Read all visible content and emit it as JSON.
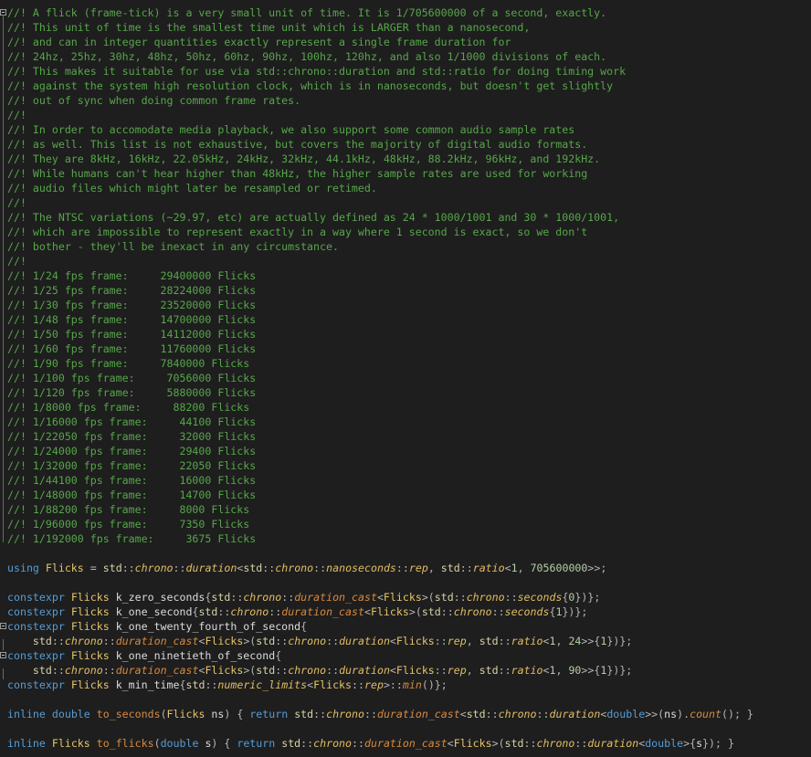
{
  "comments": [
    "//! A flick (frame-tick) is a very small unit of time. It is 1/705600000 of a second, exactly.",
    "//! This unit of time is the smallest time unit which is LARGER than a nanosecond,",
    "//! and can in integer quantities exactly represent a single frame duration for",
    "//! 24hz, 25hz, 30hz, 48hz, 50hz, 60hz, 90hz, 100hz, 120hz, and also 1/1000 divisions of each.",
    "//! This makes it suitable for use via std::chrono::duration and std::ratio for doing timing work",
    "//! against the system high resolution clock, which is in nanoseconds, but doesn't get slightly",
    "//! out of sync when doing common frame rates.",
    "//!",
    "//! In order to accomodate media playback, we also support some common audio sample rates",
    "//! as well. This list is not exhaustive, but covers the majority of digital audio formats.",
    "//! They are 8kHz, 16kHz, 22.05kHz, 24kHz, 32kHz, 44.1kHz, 48kHz, 88.2kHz, 96kHz, and 192kHz.",
    "//! While humans can't hear higher than 48kHz, the higher sample rates are used for working",
    "//! audio files which might later be resampled or retimed.",
    "//!",
    "//! The NTSC variations (~29.97, etc) are actually defined as 24 * 1000/1001 and 30 * 1000/1001,",
    "//! which are impossible to represent exactly in a way where 1 second is exact, so we don't",
    "//! bother - they'll be inexact in any circumstance.",
    "//!",
    "//! 1/24 fps frame:     29400000 Flicks",
    "//! 1/25 fps frame:     28224000 Flicks",
    "//! 1/30 fps frame:     23520000 Flicks",
    "//! 1/48 fps frame:     14700000 Flicks",
    "//! 1/50 fps frame:     14112000 Flicks",
    "//! 1/60 fps frame:     11760000 Flicks",
    "//! 1/90 fps frame:     7840000 Flicks",
    "//! 1/100 fps frame:     7056000 Flicks",
    "//! 1/120 fps frame:     5880000 Flicks",
    "//! 1/8000 fps frame:     88200 Flicks",
    "//! 1/16000 fps frame:     44100 Flicks",
    "//! 1/22050 fps frame:     32000 Flicks",
    "//! 1/24000 fps frame:     29400 Flicks",
    "//! 1/32000 fps frame:     22050 Flicks",
    "//! 1/44100 fps frame:     16000 Flicks",
    "//! 1/48000 fps frame:     14700 Flicks",
    "//! 1/88200 fps frame:     8000 Flicks",
    "//! 1/96000 fps frame:     7350 Flicks",
    "//! 1/192000 fps frame:     3675 Flicks"
  ],
  "code": [
    [],
    [
      [
        "kw",
        "using"
      ],
      [
        "p",
        " "
      ],
      [
        "ty",
        "Flicks"
      ],
      [
        "p",
        " = "
      ],
      [
        "ns",
        "std"
      ],
      [
        "p",
        "::"
      ],
      [
        "it",
        "chrono"
      ],
      [
        "p",
        "::"
      ],
      [
        "it",
        "duration"
      ],
      [
        "p",
        "<"
      ],
      [
        "ns",
        "std"
      ],
      [
        "p",
        "::"
      ],
      [
        "it",
        "chrono"
      ],
      [
        "p",
        "::"
      ],
      [
        "it",
        "nanoseconds"
      ],
      [
        "p",
        "::"
      ],
      [
        "it",
        "rep"
      ],
      [
        "p",
        ", "
      ],
      [
        "ns",
        "std"
      ],
      [
        "p",
        "::"
      ],
      [
        "it",
        "ratio"
      ],
      [
        "p",
        "<"
      ],
      [
        "num",
        "1"
      ],
      [
        "p",
        ", "
      ],
      [
        "num",
        "705600000"
      ],
      [
        "p",
        ">>;"
      ]
    ],
    [],
    [
      [
        "kw",
        "constexpr"
      ],
      [
        "p",
        " "
      ],
      [
        "ty",
        "Flicks"
      ],
      [
        "p",
        " "
      ],
      [
        "id",
        "k_zero_seconds"
      ],
      [
        "p",
        "{"
      ],
      [
        "ns",
        "std"
      ],
      [
        "p",
        "::"
      ],
      [
        "it",
        "chrono"
      ],
      [
        "p",
        "::"
      ],
      [
        "fn",
        "duration_cast"
      ],
      [
        "p",
        "<"
      ],
      [
        "ty",
        "Flicks"
      ],
      [
        "p",
        ">("
      ],
      [
        "ns",
        "std"
      ],
      [
        "p",
        "::"
      ],
      [
        "it",
        "chrono"
      ],
      [
        "p",
        "::"
      ],
      [
        "it",
        "seconds"
      ],
      [
        "p",
        "{"
      ],
      [
        "num",
        "0"
      ],
      [
        "p",
        "})};"
      ]
    ],
    [
      [
        "kw",
        "constexpr"
      ],
      [
        "p",
        " "
      ],
      [
        "ty",
        "Flicks"
      ],
      [
        "p",
        " "
      ],
      [
        "id",
        "k_one_second"
      ],
      [
        "p",
        "{"
      ],
      [
        "ns",
        "std"
      ],
      [
        "p",
        "::"
      ],
      [
        "it",
        "chrono"
      ],
      [
        "p",
        "::"
      ],
      [
        "fn",
        "duration_cast"
      ],
      [
        "p",
        "<"
      ],
      [
        "ty",
        "Flicks"
      ],
      [
        "p",
        ">("
      ],
      [
        "ns",
        "std"
      ],
      [
        "p",
        "::"
      ],
      [
        "it",
        "chrono"
      ],
      [
        "p",
        "::"
      ],
      [
        "it",
        "seconds"
      ],
      [
        "p",
        "{"
      ],
      [
        "num",
        "1"
      ],
      [
        "p",
        "})};"
      ]
    ],
    [
      [
        "kw",
        "constexpr"
      ],
      [
        "p",
        " "
      ],
      [
        "ty",
        "Flicks"
      ],
      [
        "p",
        " "
      ],
      [
        "id",
        "k_one_twenty_fourth_of_second"
      ],
      [
        "p",
        "{"
      ]
    ],
    [
      [
        "p",
        "    "
      ],
      [
        "ns",
        "std"
      ],
      [
        "p",
        "::"
      ],
      [
        "it",
        "chrono"
      ],
      [
        "p",
        "::"
      ],
      [
        "fn",
        "duration_cast"
      ],
      [
        "p",
        "<"
      ],
      [
        "ty",
        "Flicks"
      ],
      [
        "p",
        ">("
      ],
      [
        "ns",
        "std"
      ],
      [
        "p",
        "::"
      ],
      [
        "it",
        "chrono"
      ],
      [
        "p",
        "::"
      ],
      [
        "it",
        "duration"
      ],
      [
        "p",
        "<"
      ],
      [
        "ty",
        "Flicks"
      ],
      [
        "p",
        "::"
      ],
      [
        "it",
        "rep"
      ],
      [
        "p",
        ", "
      ],
      [
        "ns",
        "std"
      ],
      [
        "p",
        "::"
      ],
      [
        "it",
        "ratio"
      ],
      [
        "p",
        "<"
      ],
      [
        "num",
        "1"
      ],
      [
        "p",
        ", "
      ],
      [
        "num",
        "24"
      ],
      [
        "p",
        ">>{"
      ],
      [
        "num",
        "1"
      ],
      [
        "p",
        "})};"
      ]
    ],
    [
      [
        "kw",
        "constexpr"
      ],
      [
        "p",
        " "
      ],
      [
        "ty",
        "Flicks"
      ],
      [
        "p",
        " "
      ],
      [
        "id",
        "k_one_ninetieth_of_second"
      ],
      [
        "p",
        "{"
      ]
    ],
    [
      [
        "p",
        "    "
      ],
      [
        "ns",
        "std"
      ],
      [
        "p",
        "::"
      ],
      [
        "it",
        "chrono"
      ],
      [
        "p",
        "::"
      ],
      [
        "fn",
        "duration_cast"
      ],
      [
        "p",
        "<"
      ],
      [
        "ty",
        "Flicks"
      ],
      [
        "p",
        ">("
      ],
      [
        "ns",
        "std"
      ],
      [
        "p",
        "::"
      ],
      [
        "it",
        "chrono"
      ],
      [
        "p",
        "::"
      ],
      [
        "it",
        "duration"
      ],
      [
        "p",
        "<"
      ],
      [
        "ty",
        "Flicks"
      ],
      [
        "p",
        "::"
      ],
      [
        "it",
        "rep"
      ],
      [
        "p",
        ", "
      ],
      [
        "ns",
        "std"
      ],
      [
        "p",
        "::"
      ],
      [
        "it",
        "ratio"
      ],
      [
        "p",
        "<"
      ],
      [
        "num",
        "1"
      ],
      [
        "p",
        ", "
      ],
      [
        "num",
        "90"
      ],
      [
        "p",
        ">>{"
      ],
      [
        "num",
        "1"
      ],
      [
        "p",
        "})};"
      ]
    ],
    [
      [
        "kw",
        "constexpr"
      ],
      [
        "p",
        " "
      ],
      [
        "ty",
        "Flicks"
      ],
      [
        "p",
        " "
      ],
      [
        "id",
        "k_min_time"
      ],
      [
        "p",
        "{"
      ],
      [
        "ns",
        "std"
      ],
      [
        "p",
        "::"
      ],
      [
        "it",
        "numeric_limits"
      ],
      [
        "p",
        "<"
      ],
      [
        "ty",
        "Flicks"
      ],
      [
        "p",
        "::"
      ],
      [
        "it",
        "rep"
      ],
      [
        "p",
        ">::"
      ],
      [
        "fn",
        "min"
      ],
      [
        "p",
        "()};"
      ]
    ],
    [],
    [
      [
        "kw",
        "inline"
      ],
      [
        "p",
        " "
      ],
      [
        "kw",
        "double"
      ],
      [
        "p",
        " "
      ],
      [
        "fnn",
        "to_seconds"
      ],
      [
        "p",
        "("
      ],
      [
        "ty",
        "Flicks"
      ],
      [
        "p",
        " "
      ],
      [
        "id",
        "ns"
      ],
      [
        "p",
        ") { "
      ],
      [
        "kw",
        "return"
      ],
      [
        "p",
        " "
      ],
      [
        "ns",
        "std"
      ],
      [
        "p",
        "::"
      ],
      [
        "it",
        "chrono"
      ],
      [
        "p",
        "::"
      ],
      [
        "fn",
        "duration_cast"
      ],
      [
        "p",
        "<"
      ],
      [
        "ns",
        "std"
      ],
      [
        "p",
        "::"
      ],
      [
        "it",
        "chrono"
      ],
      [
        "p",
        "::"
      ],
      [
        "it",
        "duration"
      ],
      [
        "p",
        "<"
      ],
      [
        "kw",
        "double"
      ],
      [
        "p",
        ">>("
      ],
      [
        "id",
        "ns"
      ],
      [
        "p",
        ")."
      ],
      [
        "fn",
        "count"
      ],
      [
        "p",
        "(); }"
      ]
    ],
    [],
    [
      [
        "kw",
        "inline"
      ],
      [
        "p",
        " "
      ],
      [
        "ty",
        "Flicks"
      ],
      [
        "p",
        " "
      ],
      [
        "fnn",
        "to_flicks"
      ],
      [
        "p",
        "("
      ],
      [
        "kw",
        "double"
      ],
      [
        "p",
        " "
      ],
      [
        "id",
        "s"
      ],
      [
        "p",
        ") { "
      ],
      [
        "kw",
        "return"
      ],
      [
        "p",
        " "
      ],
      [
        "ns",
        "std"
      ],
      [
        "p",
        "::"
      ],
      [
        "it",
        "chrono"
      ],
      [
        "p",
        "::"
      ],
      [
        "fn",
        "duration_cast"
      ],
      [
        "p",
        "<"
      ],
      [
        "ty",
        "Flicks"
      ],
      [
        "p",
        ">("
      ],
      [
        "ns",
        "std"
      ],
      [
        "p",
        "::"
      ],
      [
        "it",
        "chrono"
      ],
      [
        "p",
        "::"
      ],
      [
        "it",
        "duration"
      ],
      [
        "p",
        "<"
      ],
      [
        "kw",
        "double"
      ],
      [
        "p",
        ">{"
      ],
      [
        "id",
        "s"
      ],
      [
        "p",
        "}); }"
      ]
    ]
  ]
}
